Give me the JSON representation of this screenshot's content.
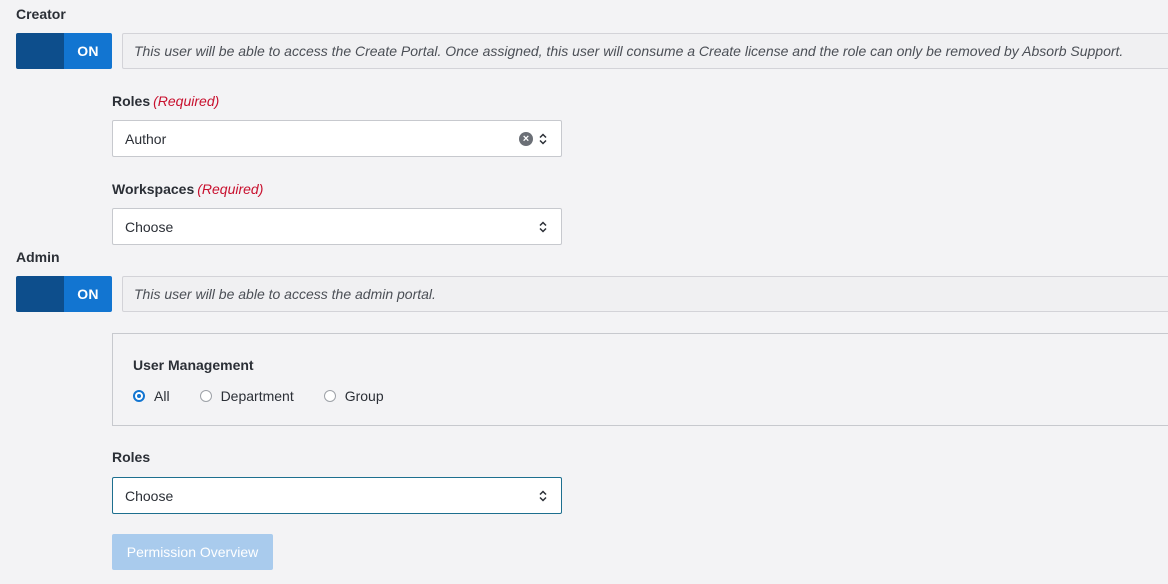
{
  "creator": {
    "label": "Creator",
    "toggle_state": "ON",
    "description": "This user will be able to access the Create Portal.  Once assigned, this user will consume a Create license and the role can only be removed by Absorb Support.",
    "roles": {
      "label": "Roles",
      "required_text": "(Required)",
      "value": "Author"
    },
    "workspaces": {
      "label": "Workspaces",
      "required_text": "(Required)",
      "value": "Choose"
    }
  },
  "admin": {
    "label": "Admin",
    "toggle_state": "ON",
    "description": "This user will be able to access the admin portal.",
    "user_management": {
      "title": "User Management",
      "options": [
        "All",
        "Department",
        "Group"
      ],
      "selected": "All"
    },
    "roles": {
      "label": "Roles",
      "value": "Choose"
    },
    "permission_button": "Permission Overview"
  },
  "colors": {
    "toggle_on": "#1275d1",
    "toggle_knob": "#0d4e8c",
    "required": "#c8102e",
    "button_disabled": "#a9cbed"
  }
}
